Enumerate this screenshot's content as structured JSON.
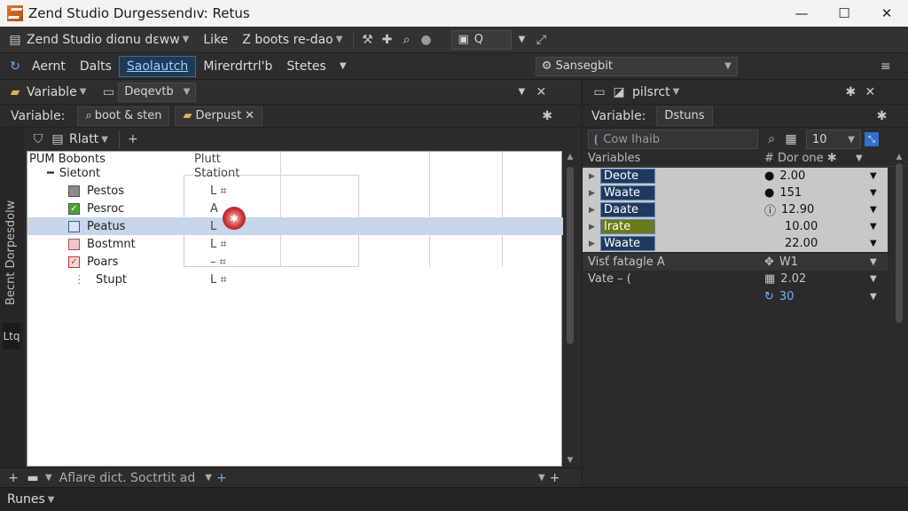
{
  "window": {
    "title": "Zend Studio Durgessendıv: Retus",
    "minimize": "—",
    "maximize": "☐",
    "close": "✕"
  },
  "menubar": {
    "workspace_label": "Zend Studio diɑnu dɛww",
    "like_label": "Like",
    "boots_label": "Z boots re-dao",
    "search_box_value": "Q"
  },
  "toolbar2": {
    "items": [
      "Aernt",
      "Dalts",
      "Saolautch",
      "Mirerdrtrl'b",
      "Stetes"
    ],
    "active_index": 2,
    "search_combo": "Sansegbit"
  },
  "left_panel": {
    "header_label": "Variable",
    "header_tab": "Deqevtb",
    "variable_label": "Variable:",
    "subtab1": "boot & sten",
    "subtab2": "Derpust",
    "toolbar_label": "Rlatt",
    "vertical_tab_text": "Becnt Dorpesdolw",
    "vertical_tab_icon": "Ltq",
    "tree_header_col1": "PUM Bobonts",
    "tree_header_col2": "Plutt",
    "tree_rows": [
      {
        "name": "Sietont",
        "value": "Stationt",
        "kind": "group"
      },
      {
        "name": "Pestos",
        "value": "L ⌗",
        "kind": "gray"
      },
      {
        "name": "Pesroc",
        "value": "A",
        "kind": "green"
      },
      {
        "name": "Peatus",
        "value": "L",
        "kind": "blue"
      },
      {
        "name": "Bostmnt",
        "value": "L ⌗",
        "kind": "pink"
      },
      {
        "name": "Poars",
        "value": "– ⌗",
        "kind": "red"
      },
      {
        "name": "Stupt",
        "value": "L ⌗",
        "kind": "plain"
      }
    ],
    "selected_row": 3,
    "breakpoint_glyph": "✱",
    "bottom_label": "Aflare dict. Soctrtit ad"
  },
  "right_panel": {
    "header_label": "pilsrct",
    "variable_label": "Variable:",
    "variable_tab": "Dstuns",
    "filter_placeholder": "Cow Ihaib",
    "count_value": "10",
    "col_variables": "Variables",
    "col_value": "# Dor one ✱",
    "rows": [
      {
        "name": "Deote",
        "value": "2.00",
        "icon": "●"
      },
      {
        "name": "Waate",
        "value": "151",
        "icon": "●"
      },
      {
        "name": "Daate",
        "value": "12.90",
        "icon": "ⓘ"
      },
      {
        "name": "Irate",
        "value": "10.00",
        "icon": ""
      },
      {
        "name": "Waate",
        "value": "22.00",
        "icon": ""
      }
    ],
    "vist_label": "Visť fatagle A",
    "vist_value": "W1",
    "vate_label": "Vate – (",
    "vate_value": "2.02",
    "extra_value": "30"
  },
  "status": {
    "runes_label": "Runes"
  },
  "colors": {
    "accent": "#3d6a96",
    "selection": "#c7d6ea",
    "value_blue": "#6fb0ff"
  }
}
